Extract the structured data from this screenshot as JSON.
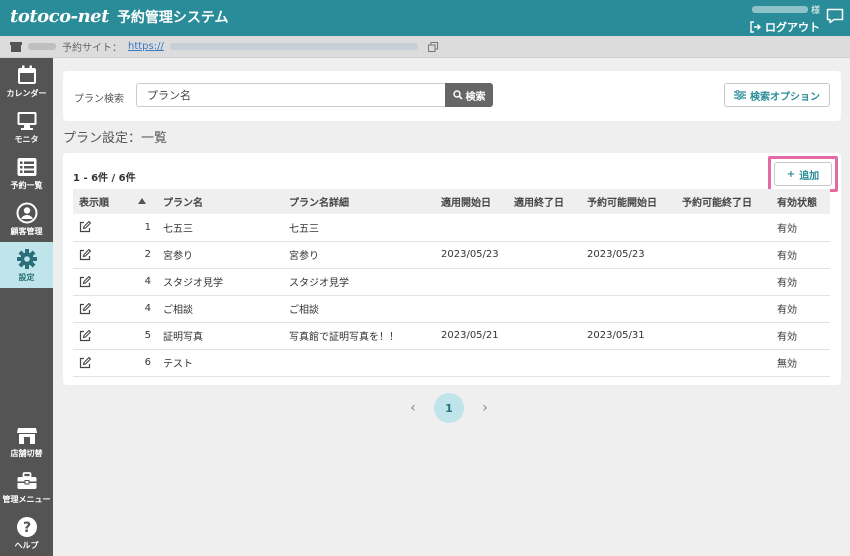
{
  "header": {
    "brand": "totoco-net",
    "system_title": "予約管理システム",
    "user_suffix": "様",
    "logout_label": "ログアウト"
  },
  "site_bar": {
    "label": "予約サイト：",
    "url_prefix": "https://"
  },
  "sidebar": {
    "items": [
      {
        "label": "カレンダー",
        "icon": "calendar-icon"
      },
      {
        "label": "モニタ",
        "icon": "monitor-icon"
      },
      {
        "label": "予約一覧",
        "icon": "list-icon"
      },
      {
        "label": "顧客管理",
        "icon": "user-icon"
      },
      {
        "label": "設定",
        "icon": "gear-icon",
        "active": true
      }
    ],
    "bottom_items": [
      {
        "label": "店舗切替",
        "icon": "store-icon"
      },
      {
        "label": "管理メニュー",
        "icon": "toolbox-icon"
      },
      {
        "label": "ヘルプ",
        "icon": "help-icon"
      }
    ]
  },
  "search": {
    "label": "プラン検索",
    "placeholder": "プラン名",
    "button_label": "検索",
    "options_label": "検索オプション"
  },
  "page_title": "プラン設定：一覧",
  "list": {
    "count_text": "1 - 6件 / 6件",
    "add_label": "追加",
    "columns": [
      "表示順",
      "プラン名",
      "プラン名詳細",
      "適用開始日",
      "適用終了日",
      "予約可能開始日",
      "予約可能終了日",
      "有効状態"
    ],
    "rows": [
      {
        "order": "1",
        "name": "七五三",
        "detail": "七五三",
        "apply_start": "",
        "apply_end": "",
        "book_start": "",
        "book_end": "",
        "status": "有効"
      },
      {
        "order": "2",
        "name": "宮参り",
        "detail": "宮参り",
        "apply_start": "2023/05/23",
        "apply_end": "",
        "book_start": "2023/05/23",
        "book_end": "",
        "status": "有効"
      },
      {
        "order": "4",
        "name": "スタジオ見学",
        "detail": "スタジオ見学",
        "apply_start": "",
        "apply_end": "",
        "book_start": "",
        "book_end": "",
        "status": "有効"
      },
      {
        "order": "4",
        "name": "ご相談",
        "detail": "ご相談",
        "apply_start": "",
        "apply_end": "",
        "book_start": "",
        "book_end": "",
        "status": "有効"
      },
      {
        "order": "5",
        "name": "証明写真",
        "detail": "写真館で証明写真を！！",
        "apply_start": "2023/05/21",
        "apply_end": "",
        "book_start": "2023/05/31",
        "book_end": "",
        "status": "有効"
      },
      {
        "order": "6",
        "name": "テスト",
        "detail": "",
        "apply_start": "",
        "apply_end": "",
        "book_start": "",
        "book_end": "",
        "status": "無効"
      }
    ]
  },
  "pagination": {
    "current_page": "1",
    "prev": "‹",
    "next": "›"
  },
  "colors": {
    "primary": "#2a8c99",
    "sidebar": "#545454",
    "active_nav": "#bfe5ea",
    "highlight": "#e46aa6"
  }
}
